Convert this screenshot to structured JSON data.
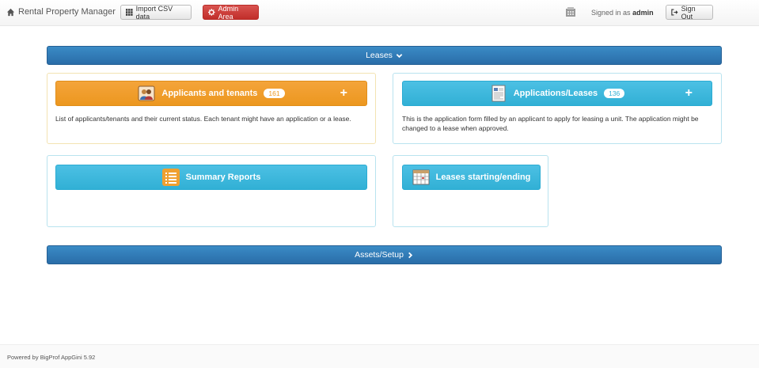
{
  "navbar": {
    "brand": "Rental Property Manager",
    "import_csv_label": "Import CSV data",
    "admin_area_label": "Admin Area",
    "signed_in_prefix": "Signed in as",
    "username": "admin",
    "sign_out_label": "Sign Out"
  },
  "sections": {
    "leases_label": "Leases",
    "assets_label": "Assets/Setup"
  },
  "tiles": {
    "applicants": {
      "label": "Applicants and tenants",
      "count": "161",
      "description": "List of applicants/tenants and their current status. Each tenant might have an application or a lease."
    },
    "applications": {
      "label": "Applications/Leases",
      "count": "136",
      "description_line1": "This is the application form filled by an applicant to apply for leasing a unit. The application might be",
      "description_line2": "changed to a lease when approved."
    },
    "summary": {
      "label": "Summary Reports"
    },
    "leases_starting": {
      "label": "Leases starting/ending"
    }
  },
  "footer": {
    "text": "Powered by BigProf AppGini 5.92"
  },
  "colors": {
    "section_bar": "#2a6da8",
    "tile_orange": "#ec971f",
    "tile_cyan": "#31b0d5",
    "danger": "#c9302c"
  }
}
